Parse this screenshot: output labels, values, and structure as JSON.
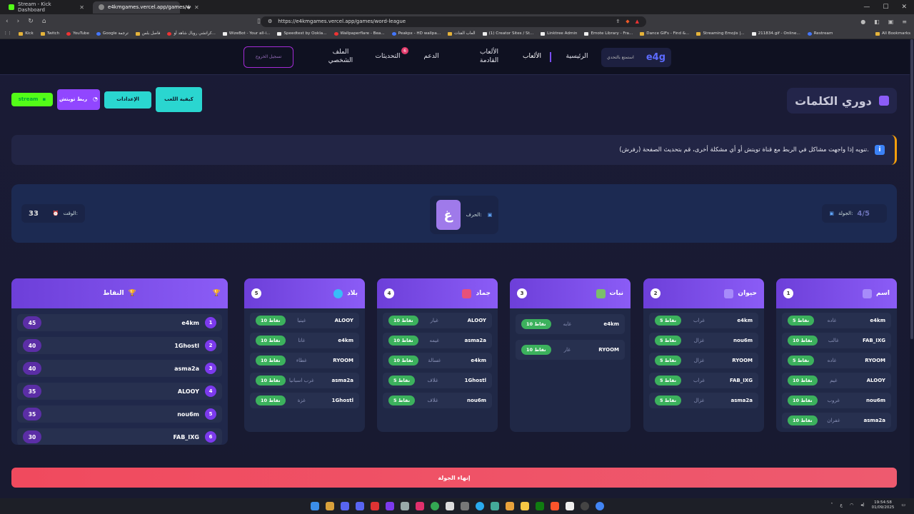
{
  "browser": {
    "tabs": [
      {
        "title": "Stream - Kick Dashboard",
        "active": false
      },
      {
        "title": "e4kmgames.vercel.app/games/w",
        "active": true
      }
    ],
    "url": "https://e4kmgames.vercel.app/games/word-league",
    "bookmarks": [
      "Kick",
      "Twitch",
      "YouTube",
      "Google ترجمة",
      "فاصل بلس",
      "كراتشي رويال شاهد أو...",
      "WizeBot - Your all-i...",
      "Speedtest by Ookla...",
      "Wallpaperflare - Bea...",
      "Peakpx - HD wallpa...",
      "العاب القنات",
      "(1) Creator Sites / St...",
      "Linktree Admin",
      "Emote Library - Fra...",
      "Dance GIFs - Find &...",
      "Streaming Emojis |...",
      "211834.gif - Online...",
      "Restream"
    ],
    "all_bookmarks": "All Bookmarks"
  },
  "nav": {
    "logo": "e4g",
    "logo_sub": "استمتع بالتحدي",
    "home": "الرئيسية",
    "games": "الألعاب",
    "upcoming": "الألعاب القادمة",
    "support": "الدعم",
    "updates": "التحديثات",
    "updates_badge": "6",
    "profile": "الملف الشخصي",
    "signout": "تسجيل الخروج"
  },
  "page": {
    "title": "دوري الكلمات",
    "how_to_play": "كيفية اللعب",
    "settings": "الإعدادات",
    "link_twitch": "ربط تويتش",
    "stream_btn": "stream",
    "notice": "تنويه إذا واجهت مشاكل في الربط مع قناة تويتش أو أي مشكلة أخرى، قم بتحديث الصفحة (رفرش)."
  },
  "round": {
    "round_label": "الجولة:",
    "round_value": "4/5",
    "letter_label": "الحرف:",
    "letter": "غ",
    "time_label": "الوقت:",
    "time_value": "33"
  },
  "categories": [
    {
      "num": "1",
      "name": "اسم",
      "rows": [
        {
          "player": "e4km",
          "word": "غاده",
          "points": "5 نقاط"
        },
        {
          "player": "FAB_IXG",
          "word": "غالب",
          "points": "10 نقاط"
        },
        {
          "player": "RYOOM",
          "word": "غاده",
          "points": "5 نقاط"
        },
        {
          "player": "ALOOY",
          "word": "غيم",
          "points": "10 نقاط"
        },
        {
          "player": "nou6m",
          "word": "غروب",
          "points": "10 نقاط"
        },
        {
          "player": "asma2a",
          "word": "غفران",
          "points": "10 نقاط"
        }
      ]
    },
    {
      "num": "2",
      "name": "حيوان",
      "rows": [
        {
          "player": "e4km",
          "word": "غراب",
          "points": "5 نقاط"
        },
        {
          "player": "nou6m",
          "word": "غزال",
          "points": "5 نقاط"
        },
        {
          "player": "RYOOM",
          "word": "غزال",
          "points": "5 نقاط"
        },
        {
          "player": "FAB_IXG",
          "word": "غراب",
          "points": "5 نقاط"
        },
        {
          "player": "asma2a",
          "word": "غزال",
          "points": "5 نقاط"
        }
      ]
    },
    {
      "num": "3",
      "name": "نبات",
      "rows": [
        {
          "player": "e4km",
          "word": "غابه",
          "points": "10 نقاط"
        },
        {
          "player": "RYOOM",
          "word": "غار",
          "points": "10 نقاط"
        }
      ]
    },
    {
      "num": "4",
      "name": "جماد",
      "rows": [
        {
          "player": "ALOOY",
          "word": "غيار",
          "points": "10 نقاط"
        },
        {
          "player": "asma2a",
          "word": "غيمه",
          "points": "10 نقاط"
        },
        {
          "player": "e4km",
          "word": "غسالة",
          "points": "10 نقاط"
        },
        {
          "player": "1Ghostl",
          "word": "غلاف",
          "points": "5 نقاط"
        },
        {
          "player": "nou6m",
          "word": "غلاف",
          "points": "5 نقاط"
        }
      ]
    },
    {
      "num": "5",
      "name": "بلاد",
      "rows": [
        {
          "player": "ALOOY",
          "word": "غينيا",
          "points": "10 نقاط"
        },
        {
          "player": "e4km",
          "word": "غانا",
          "points": "10 نقاط"
        },
        {
          "player": "RYOOM",
          "word": "غطاء",
          "points": "10 نقاط"
        },
        {
          "player": "asma2a",
          "word": "غرب اسبانيا",
          "points": "10 نقاط"
        },
        {
          "player": "1Ghostl",
          "word": "غزة",
          "points": "10 نقاط"
        }
      ]
    }
  ],
  "scores": {
    "title": "النقاط",
    "rows": [
      {
        "rank": "1",
        "player": "e4km",
        "points": "45"
      },
      {
        "rank": "2",
        "player": "1Ghostl",
        "points": "40"
      },
      {
        "rank": "3",
        "player": "asma2a",
        "points": "40"
      },
      {
        "rank": "4",
        "player": "ALOOY",
        "points": "35"
      },
      {
        "rank": "5",
        "player": "nou6m",
        "points": "35"
      },
      {
        "rank": "6",
        "player": "FAB_IXG",
        "points": "30"
      }
    ]
  },
  "end_round": "إنهاء الجولة",
  "taskbar": {
    "lang": "ع",
    "time": "19:54:58",
    "date": "01/09/2025"
  }
}
